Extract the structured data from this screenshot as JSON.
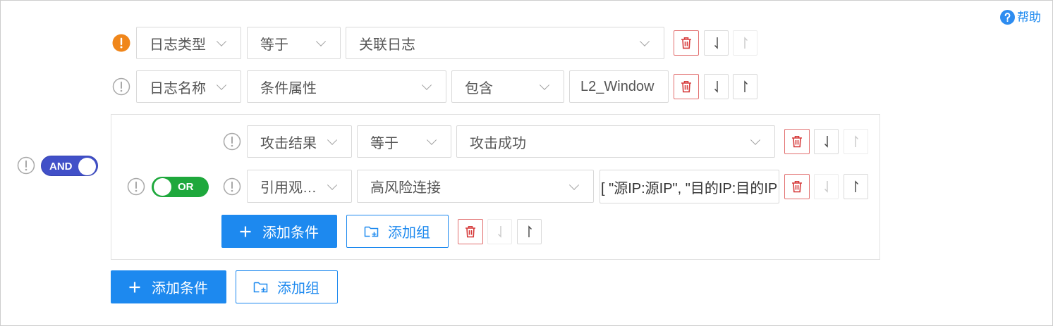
{
  "help": {
    "label": "帮助",
    "icon": "question-circle-icon"
  },
  "colors": {
    "primary": "#1d89ef",
    "and_toggle": "#4150c8",
    "or_toggle": "#1ea83c",
    "warning": "#f0861a",
    "danger": "#d63b3b"
  },
  "root": {
    "logic": "AND",
    "logic_toggle_checked": true,
    "conditions": [
      {
        "status_icon": "warning-filled-icon",
        "field": "日志类型",
        "operator": "等于",
        "value": "关联日志",
        "can_move_down": true,
        "can_move_up": false
      },
      {
        "status_icon": "exclamation-circle-icon",
        "field": "日志名称",
        "attribute": "条件属性",
        "operator": "包含",
        "value": "L2_Window",
        "can_move_down": true,
        "can_move_up": true
      }
    ],
    "group": {
      "logic": "OR",
      "logic_toggle_checked": false,
      "conditions": [
        {
          "status_icon": "exclamation-circle-icon",
          "field": "攻击结果",
          "operator": "等于",
          "value": "攻击成功",
          "can_move_down": true,
          "can_move_up": false
        },
        {
          "status_icon": "exclamation-circle-icon",
          "field": "引用观…",
          "reference": "高风险连接",
          "value": "[ \"源IP:源IP\", \"目的IP:目的IP",
          "can_move_down": false,
          "can_move_up": true
        }
      ],
      "add_condition_label": "添加条件",
      "add_group_label": "添加组",
      "can_move_down": false,
      "can_move_up": true
    },
    "add_condition_label": "添加条件",
    "add_group_label": "添加组"
  }
}
